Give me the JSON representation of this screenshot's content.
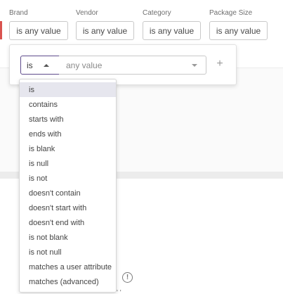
{
  "filters": [
    {
      "label": "Brand",
      "value": "is any value"
    },
    {
      "label": "Vendor",
      "value": "is any value"
    },
    {
      "label": "Category",
      "value": "is any value"
    },
    {
      "label": "Package Size",
      "value": "is any value"
    }
  ],
  "popover": {
    "operator_value": "is",
    "value_placeholder": "any value",
    "add_label": "+"
  },
  "dropdown": {
    "selected": "is",
    "options": [
      "is",
      "contains",
      "starts with",
      "ends with",
      "is blank",
      "is null",
      "is not",
      "doesn't contain",
      "doesn't start with",
      "doesn't end with",
      "is not blank",
      "is not null",
      "matches a user attribute",
      "matches (advanced)"
    ]
  },
  "background": {
    "warning_glyph": "!",
    "peek_text": "' '"
  },
  "colors": {
    "accent_edge": "#d9534f",
    "focus_border": "#5e4b8b",
    "selected_bg": "#e6e6ee"
  }
}
